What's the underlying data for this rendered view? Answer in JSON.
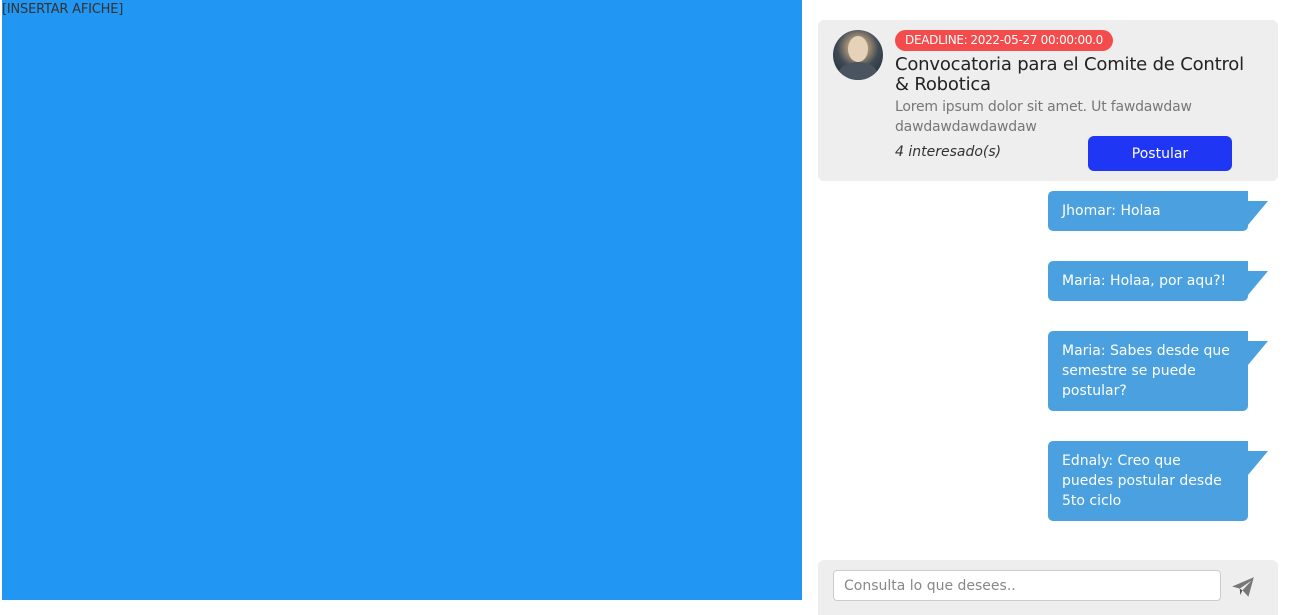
{
  "poster": {
    "label": "[INSERTAR AFICHE]"
  },
  "card": {
    "deadline_label": "DEADLINE:",
    "deadline_value": "2022-05-27 00:00:00.0",
    "title": "Convocatoria para el Comite de Control & Robotica",
    "description": "Lorem ipsum dolor sit amet. Ut fawdawdawdawdawdawdawdaw",
    "interested": "4 interesado(s)",
    "apply_label": "Postular"
  },
  "messages": [
    {
      "text": "Jhomar: Holaa"
    },
    {
      "text": "Maria: Holaa, por aqu?!"
    },
    {
      "text": "Maria: Sabes desde que semestre se puede postular?"
    },
    {
      "text": "Ednaly: Creo que puedes postular desde 5to ciclo"
    }
  ],
  "composer": {
    "placeholder": "Consulta lo que desees..",
    "send_icon": "paper-plane-icon"
  },
  "colors": {
    "poster_bg": "#2196f3",
    "deadline_bg": "#f44c4c",
    "button_bg": "#1f36f5",
    "message_bg": "#4ba1df",
    "card_bg": "#eeeeee"
  }
}
